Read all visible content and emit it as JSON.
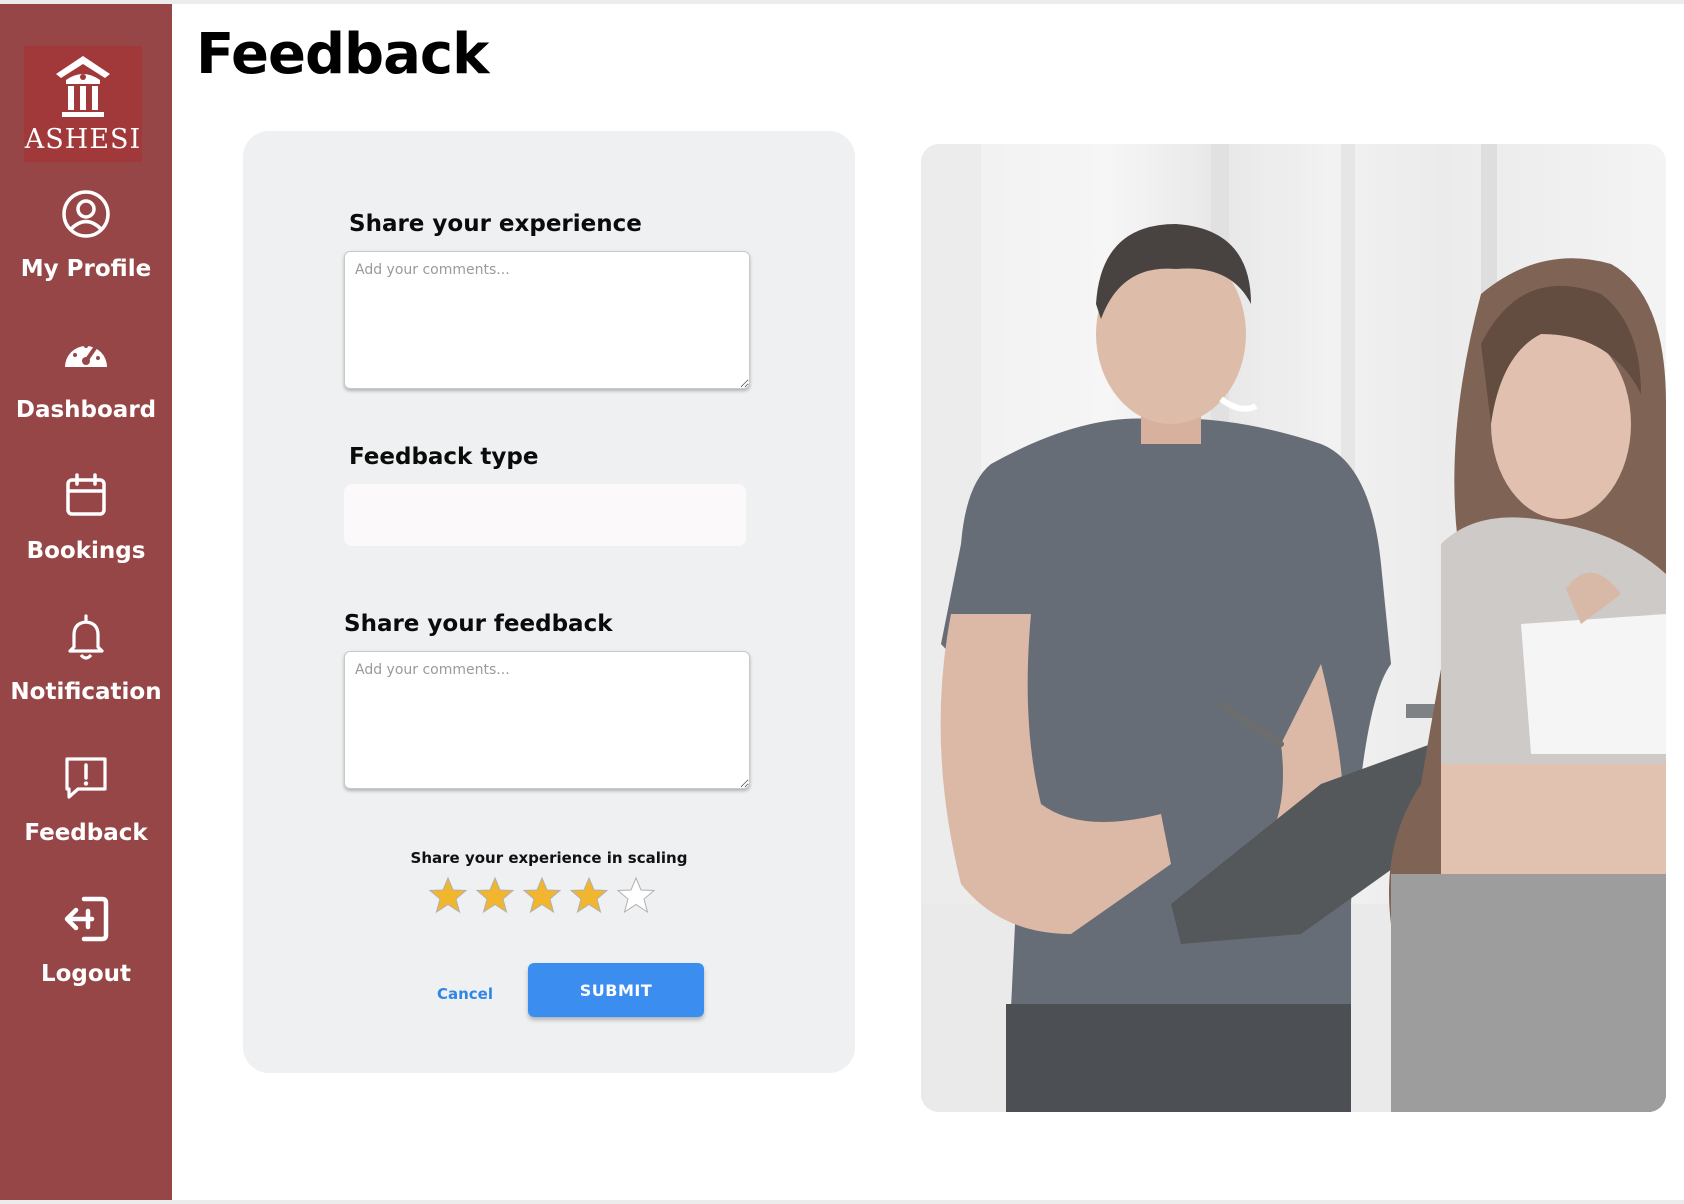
{
  "app": {
    "logo_text": "ASHESI",
    "page_title": "Feedback",
    "brand_color": "#974647"
  },
  "sidebar": {
    "items": [
      {
        "label": "My Profile",
        "icon": "user-circle-icon"
      },
      {
        "label": "Dashboard",
        "icon": "speedometer-icon"
      },
      {
        "label": "Bookings",
        "icon": "calendar-icon"
      },
      {
        "label": "Notification",
        "icon": "bell-icon"
      },
      {
        "label": "Feedback",
        "icon": "feedback-alert-icon"
      },
      {
        "label": "Logout",
        "icon": "logout-icon"
      }
    ]
  },
  "form": {
    "experience": {
      "label": "Share your experience",
      "placeholder": "Add your comments...",
      "value": ""
    },
    "feedback_type": {
      "label": "Feedback type",
      "value": ""
    },
    "feedback": {
      "label": "Share your feedback",
      "placeholder": "Add your comments...",
      "value": ""
    },
    "rating": {
      "label": "Share your experience in scaling",
      "value": 4,
      "max": 5,
      "filled_color": "#f2b62e",
      "empty_color": "#ffffff"
    },
    "cancel_label": "Cancel",
    "submit_label": "SUBMIT",
    "accent_color": "#3b8ef0"
  },
  "photo": {
    "subject": "gym-trainer-with-client-photo"
  }
}
